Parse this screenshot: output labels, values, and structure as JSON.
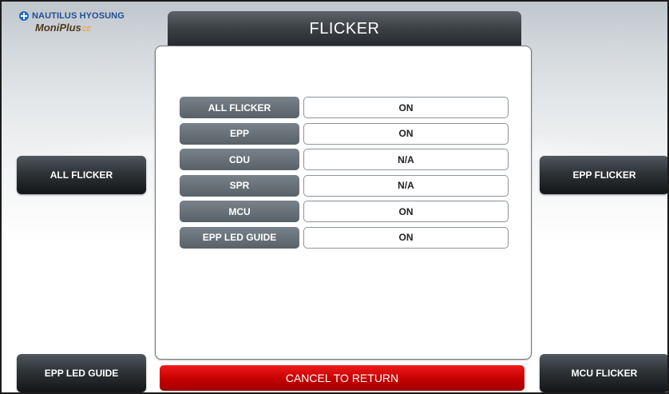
{
  "brand": {
    "company": "NAUTILUS HYOSUNG",
    "product": "MoniPlus",
    "product_suffix": "CE"
  },
  "screen": {
    "title": "FLICKER"
  },
  "status_rows": [
    {
      "label": "ALL FLICKER",
      "value": "ON"
    },
    {
      "label": "EPP",
      "value": "ON"
    },
    {
      "label": "CDU",
      "value": "N/A"
    },
    {
      "label": "SPR",
      "value": "N/A"
    },
    {
      "label": "MCU",
      "value": "ON"
    },
    {
      "label": "EPP LED GUIDE",
      "value": "ON"
    }
  ],
  "buttons": {
    "left_top": "ALL FLICKER",
    "left_bottom": "EPP LED GUIDE",
    "right_top": "EPP FLICKER",
    "right_bottom": "MCU FLICKER",
    "cancel": "CANCEL TO RETURN"
  },
  "colors": {
    "cancel": "#c40000",
    "title_bar": "#3a3f44",
    "label_bg": "#656e75"
  }
}
